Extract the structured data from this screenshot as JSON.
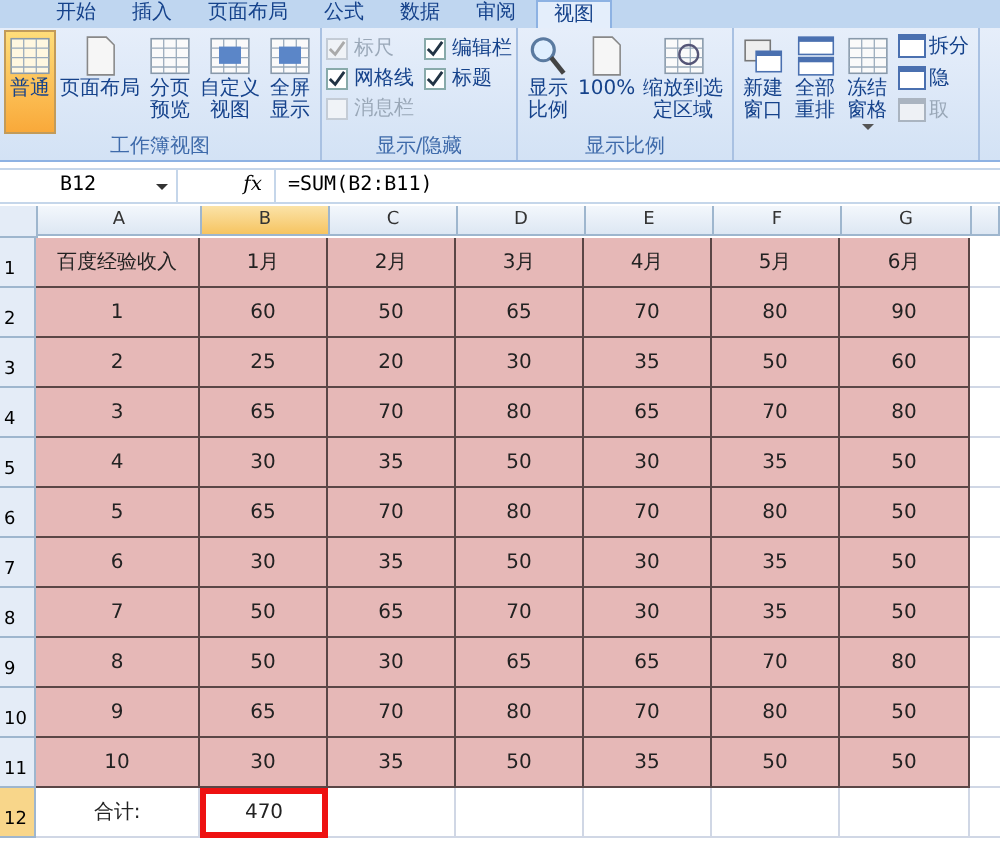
{
  "tabs": [
    {
      "label": "开始",
      "selected": false
    },
    {
      "label": "插入",
      "selected": false
    },
    {
      "label": "页面布局",
      "selected": false
    },
    {
      "label": "公式",
      "selected": false
    },
    {
      "label": "数据",
      "selected": false
    },
    {
      "label": "审阅",
      "selected": false
    },
    {
      "label": "视图",
      "selected": true
    }
  ],
  "ribbon": {
    "groups": [
      {
        "title": "工作簿视图",
        "items": [
          {
            "kind": "big",
            "label": "普通",
            "selected": true
          },
          {
            "kind": "big",
            "label": "页面布局",
            "selected": false
          },
          {
            "kind": "big",
            "label": "分页预览",
            "selected": false
          },
          {
            "kind": "big",
            "label": "自定义视图",
            "selected": false
          },
          {
            "kind": "big",
            "label": "全屏显示",
            "selected": false
          }
        ]
      },
      {
        "title": "显示/隐藏",
        "items": [
          {
            "kind": "check",
            "label": "标尺",
            "checked": true,
            "disabled": true
          },
          {
            "kind": "check",
            "label": "编辑栏",
            "checked": true,
            "disabled": false
          },
          {
            "kind": "check",
            "label": "网格线",
            "checked": true,
            "disabled": false
          },
          {
            "kind": "check",
            "label": "标题",
            "checked": true,
            "disabled": false
          },
          {
            "kind": "check",
            "label": "消息栏",
            "checked": false,
            "disabled": true
          }
        ]
      },
      {
        "title": "显示比例",
        "items": [
          {
            "kind": "big",
            "label": "显示比例",
            "selected": false
          },
          {
            "kind": "big",
            "label": "100%",
            "selected": false
          },
          {
            "kind": "big",
            "label": "缩放到选定区域",
            "selected": false
          }
        ]
      },
      {
        "items": [
          {
            "kind": "big",
            "label": "新建窗口",
            "selected": false
          },
          {
            "kind": "big",
            "label": "全部重排",
            "selected": false
          },
          {
            "kind": "big",
            "label": "冻结窗格",
            "selected": false,
            "dropdown": true
          },
          {
            "kind": "small",
            "label": "拆分",
            "disabled": false
          },
          {
            "kind": "small",
            "label": "隐",
            "disabled": false
          },
          {
            "kind": "small",
            "label": "取",
            "disabled": true
          }
        ]
      }
    ]
  },
  "formula_bar": {
    "name_box": "B12",
    "fx": "fx",
    "formula": "=SUM(B2:B11)"
  },
  "sheet": {
    "columns": [
      {
        "label": "A",
        "selected": false
      },
      {
        "label": "B",
        "selected": true
      },
      {
        "label": "C",
        "selected": false
      },
      {
        "label": "D",
        "selected": false
      },
      {
        "label": "E",
        "selected": false
      },
      {
        "label": "F",
        "selected": false
      },
      {
        "label": "G",
        "selected": false
      }
    ],
    "rows": [
      {
        "label": "1",
        "kind": "data",
        "cells": [
          "百度经验收入",
          "1月",
          "2月",
          "3月",
          "4月",
          "5月",
          "6月"
        ]
      },
      {
        "label": "2",
        "kind": "data",
        "cells": [
          "1",
          "60",
          "50",
          "65",
          "70",
          "80",
          "90"
        ]
      },
      {
        "label": "3",
        "kind": "data",
        "cells": [
          "2",
          "25",
          "20",
          "30",
          "35",
          "50",
          "60"
        ]
      },
      {
        "label": "4",
        "kind": "data",
        "cells": [
          "3",
          "65",
          "70",
          "80",
          "65",
          "70",
          "80"
        ]
      },
      {
        "label": "5",
        "kind": "data",
        "cells": [
          "4",
          "30",
          "35",
          "50",
          "30",
          "35",
          "50"
        ]
      },
      {
        "label": "6",
        "kind": "data",
        "cells": [
          "5",
          "65",
          "70",
          "80",
          "70",
          "80",
          "50"
        ]
      },
      {
        "label": "7",
        "kind": "data",
        "cells": [
          "6",
          "30",
          "35",
          "50",
          "30",
          "35",
          "50"
        ]
      },
      {
        "label": "8",
        "kind": "data",
        "cells": [
          "7",
          "50",
          "65",
          "70",
          "30",
          "35",
          "50"
        ]
      },
      {
        "label": "9",
        "kind": "data",
        "cells": [
          "8",
          "50",
          "30",
          "65",
          "65",
          "70",
          "80"
        ]
      },
      {
        "label": "10",
        "kind": "data",
        "cells": [
          "9",
          "65",
          "70",
          "80",
          "70",
          "80",
          "50"
        ]
      },
      {
        "label": "11",
        "kind": "data",
        "cells": [
          "10",
          "30",
          "35",
          "50",
          "35",
          "50",
          "50"
        ]
      },
      {
        "label": "12",
        "kind": "total",
        "cells": [
          {
            "text": "合计:",
            "selected": false
          },
          {
            "text": "470",
            "selected": true
          }
        ]
      }
    ]
  }
}
